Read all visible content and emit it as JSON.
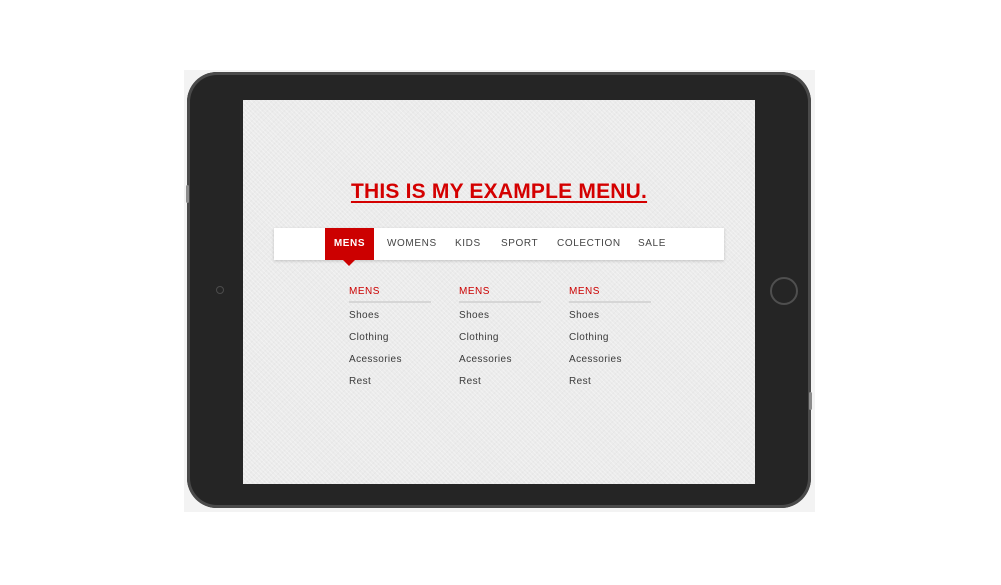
{
  "colors": {
    "accent": "#cc0000",
    "headline": "#d40000",
    "tablet_frame": "#252525",
    "screen_bg": "#ebebeb",
    "nav_bg": "#ffffff"
  },
  "page": {
    "headline": "THIS IS MY EXAMPLE MENU."
  },
  "nav": {
    "items": [
      {
        "label": "MENS",
        "active": true
      },
      {
        "label": "WOMENS",
        "active": false
      },
      {
        "label": "KIDS",
        "active": false
      },
      {
        "label": "SPORT",
        "active": false
      },
      {
        "label": "COLECTION",
        "active": false
      },
      {
        "label": "SALE",
        "active": false
      }
    ]
  },
  "dropdown": {
    "columns": [
      {
        "heading": "MENS",
        "links": [
          "Shoes",
          "Clothing",
          "Acessories",
          "Rest"
        ]
      },
      {
        "heading": "MENS",
        "links": [
          "Shoes",
          "Clothing",
          "Acessories",
          "Rest"
        ]
      },
      {
        "heading": "MENS",
        "links": [
          "Shoes",
          "Clothing",
          "Acessories",
          "Rest"
        ]
      }
    ]
  }
}
